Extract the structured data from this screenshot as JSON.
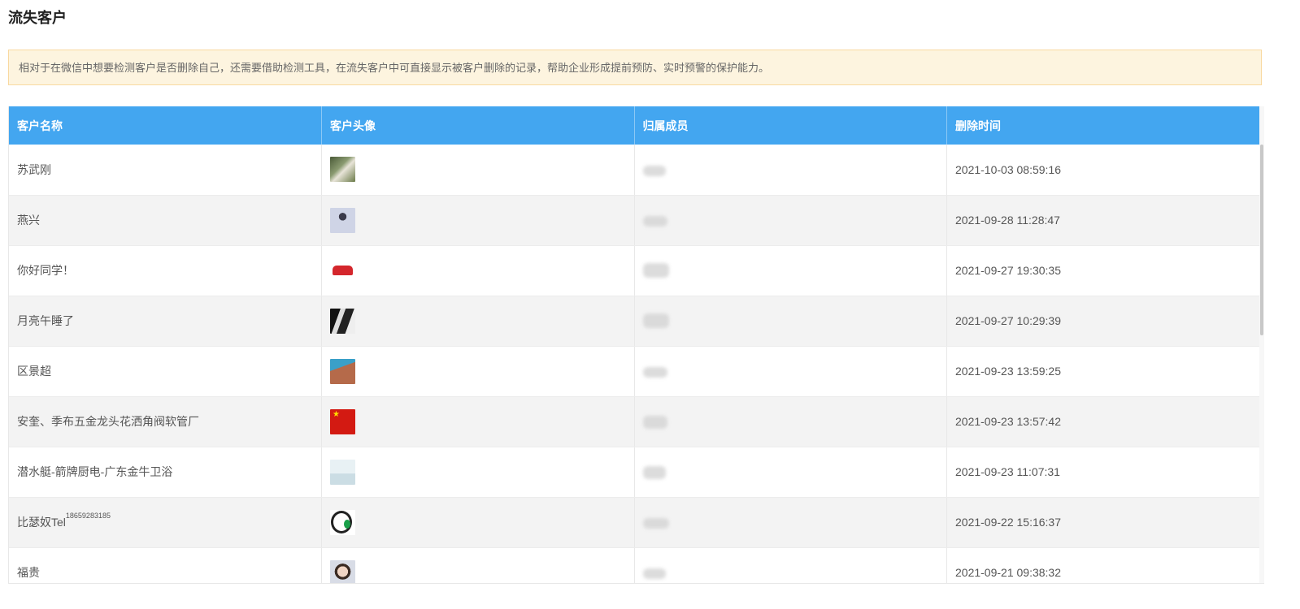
{
  "page": {
    "title": "流失客户",
    "notice": "相对于在微信中想要检测客户是否删除自己，还需要借助检测工具，在流失客户中可直接显示被客户删除的记录，帮助企业形成提前预防、实时预警的保护能力。"
  },
  "table": {
    "columns": [
      "客户名称",
      "客户头像",
      "归属成员",
      "删除时间"
    ],
    "rows": [
      {
        "name": "苏武刚",
        "avatar_icon": "duck-photo",
        "deleted_at": "2021-10-03 08:59:16"
      },
      {
        "name": "燕兴",
        "avatar_icon": "portrait-photo",
        "deleted_at": "2021-09-28 11:28:47"
      },
      {
        "name": "你好同学！",
        "avatar_icon": "red-logo",
        "deleted_at": "2021-09-27 19:30:35"
      },
      {
        "name": "月亮午睡了",
        "avatar_icon": "anime-photo",
        "deleted_at": "2021-09-27 10:29:39"
      },
      {
        "name": "区景超",
        "avatar_icon": "pool-photo",
        "deleted_at": "2021-09-23 13:59:25"
      },
      {
        "name": "安奎、季布五金龙头花洒角阀软管厂",
        "avatar_icon": "china-flag",
        "deleted_at": "2021-09-23 13:57:42"
      },
      {
        "name": "潜水艇-箭牌厨电-广东金牛卫浴",
        "avatar_icon": "placeholder-image",
        "deleted_at": "2021-09-23 11:07:31"
      },
      {
        "name": "比瑟奴Tel",
        "name_sup": "18659283185",
        "avatar_icon": "green-drop-logo",
        "deleted_at": "2021-09-22 15:16:37"
      },
      {
        "name": "福贵",
        "avatar_icon": "girl-photo",
        "deleted_at": "2021-09-21 09:38:32"
      }
    ]
  },
  "colors": {
    "header_bg": "#43a6f0",
    "notice_bg": "#fdf4df",
    "notice_border": "#f9d9a0"
  }
}
